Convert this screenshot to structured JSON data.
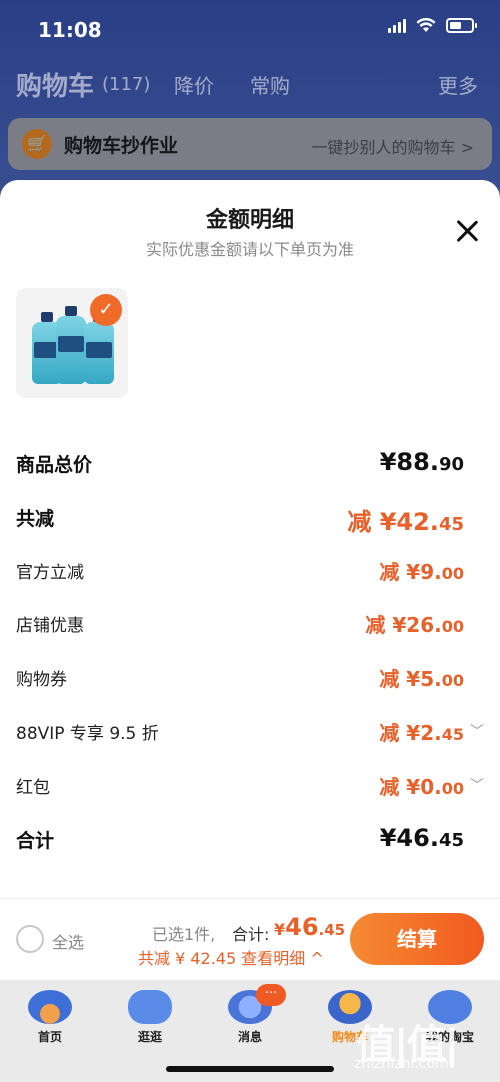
{
  "status_bar": {
    "time": "11:08"
  },
  "cart_header": {
    "title": "购物车",
    "count": "(117)",
    "tabs": [
      "降价",
      "常购"
    ],
    "more": "更多"
  },
  "copy_banner": {
    "title": "购物车抄作业",
    "subtitle": "一键抄别人的购物车 >"
  },
  "sheet": {
    "title": "金额明细",
    "subtitle": "实际优惠金额请以下单页为准",
    "product": {
      "selected": true
    },
    "rows": [
      {
        "label": "商品总价",
        "value": "¥88.",
        "cents": "90"
      },
      {
        "label": "共减",
        "value": "减 ¥42.",
        "cents": "45"
      },
      {
        "label": "官方立减",
        "value": "减 ¥9.",
        "cents": "00"
      },
      {
        "label": "店铺优惠",
        "value": "减 ¥26.",
        "cents": "00"
      },
      {
        "label": "购物券",
        "value": "减 ¥5.",
        "cents": "00"
      },
      {
        "label": "88VIP 专享 9.5 折",
        "value": "减 ¥2.",
        "cents": "45"
      },
      {
        "label": "红包",
        "value": "减 ¥0.",
        "cents": "00"
      },
      {
        "label": "合计",
        "value": "¥46.",
        "cents": "45"
      }
    ]
  },
  "checkout": {
    "select_all": "全选",
    "selected_count": "已选1件,",
    "total_label": "合计:",
    "total_symbol": "¥",
    "total_main": "46",
    "total_cents": ".45",
    "savings_link": "共减 ¥ 42.45 查看明细 ^",
    "button": "结算"
  },
  "tab_bar": {
    "tabs": [
      {
        "label": "首页"
      },
      {
        "label": "逛逛"
      },
      {
        "label": "消息",
        "badge": "···"
      },
      {
        "label": "购物车"
      },
      {
        "label": "我的淘宝"
      }
    ]
  },
  "watermark": {
    "mark": "值|值|值",
    "url": "zhizhizhi.com"
  },
  "colors": {
    "accent_orange": "#e8612b",
    "header_blue": "#2b3f86",
    "button_gradient_start": "#f58a33",
    "button_gradient_end": "#f25a1f"
  }
}
